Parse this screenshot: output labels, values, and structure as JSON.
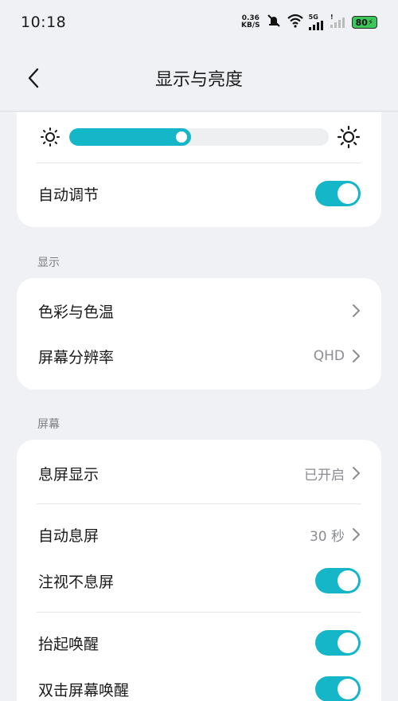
{
  "status_bar": {
    "time": "10:18",
    "net_speed_value": "0.36",
    "net_speed_unit": "KB/S",
    "network_type": "5G",
    "battery": "80"
  },
  "header": {
    "title": "显示与亮度"
  },
  "brightness": {
    "level": 0.47,
    "auto_adjust_label": "自动调节",
    "auto_adjust_on": true
  },
  "sections": {
    "display": "显示",
    "screen": "屏幕"
  },
  "display_items": [
    {
      "label": "色彩与色温",
      "value": ""
    },
    {
      "label": "屏幕分辨率",
      "value": "QHD"
    }
  ],
  "screen_items": {
    "aod": {
      "label": "息屏显示",
      "value": "已开启"
    },
    "auto_off": {
      "label": "自动息屏",
      "value": "30 秒"
    },
    "attention": {
      "label": "注视不息屏",
      "on": true
    },
    "raise_wake": {
      "label": "抬起唤醒",
      "on": true
    },
    "double_tap": {
      "label": "双击屏幕唤醒",
      "on": true
    }
  },
  "colors": {
    "accent": "#14B6C8",
    "background": "#F0F1F4"
  }
}
